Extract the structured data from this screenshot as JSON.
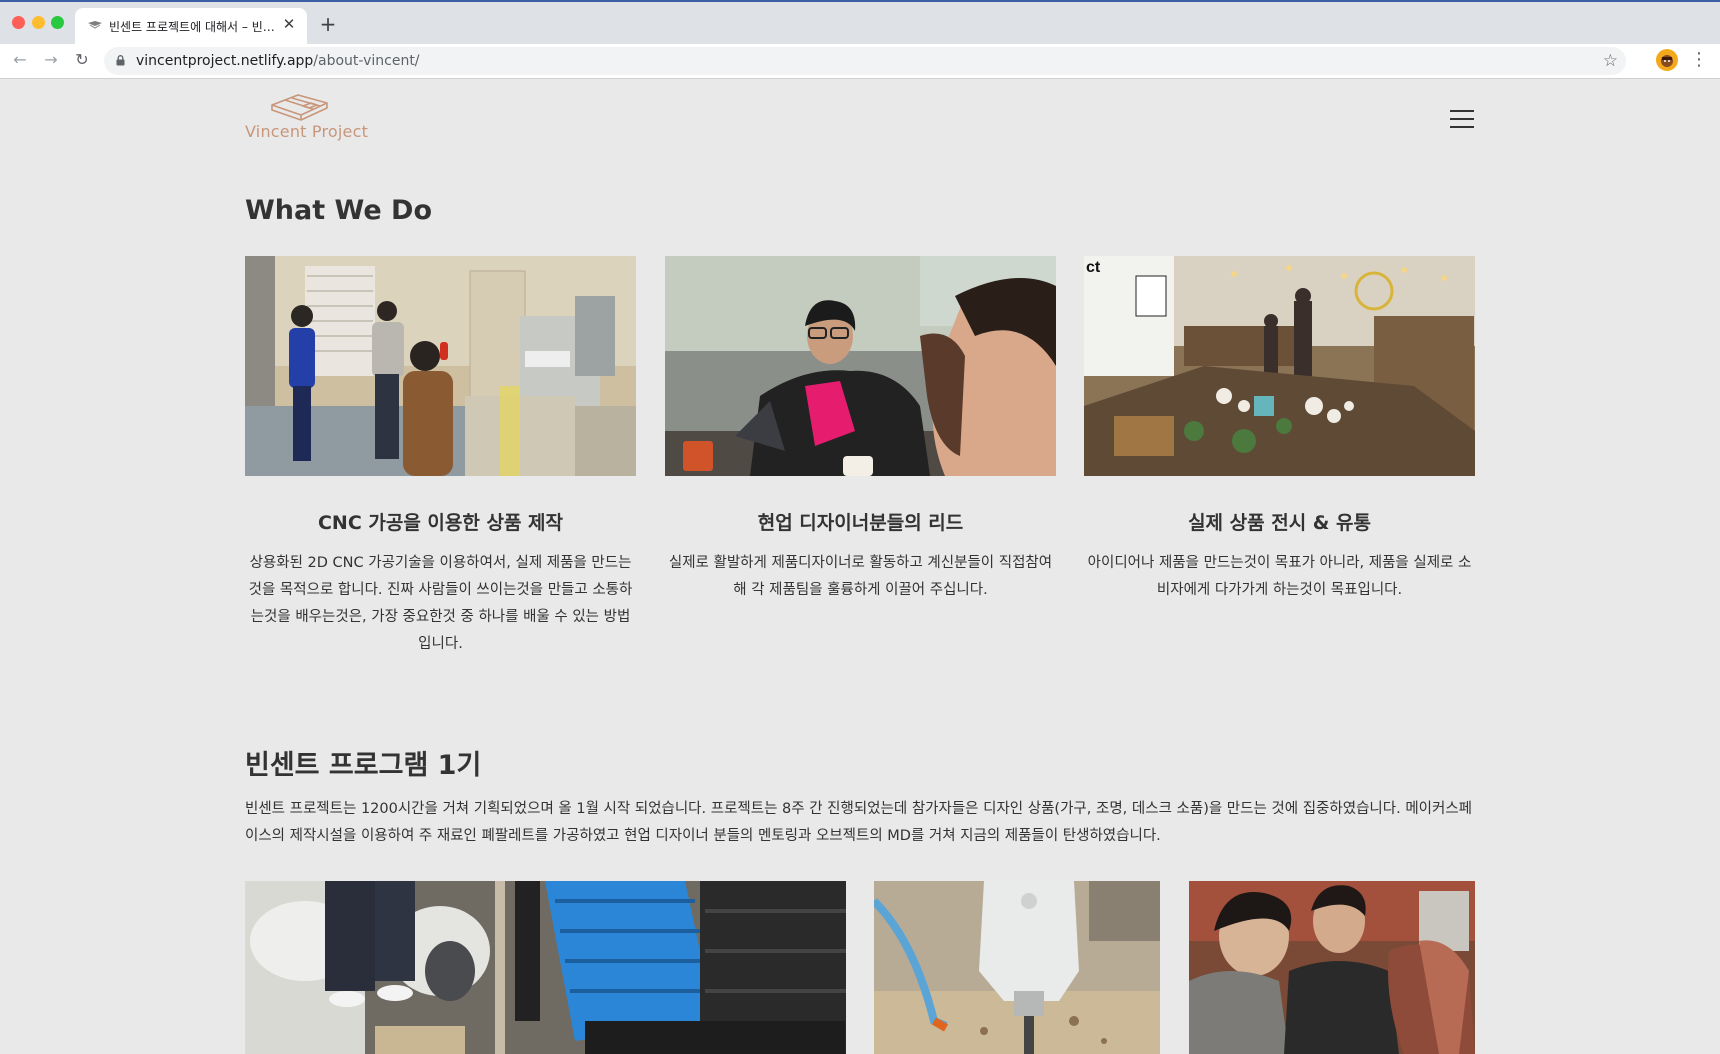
{
  "browser": {
    "tab_title": "빈센트 프로젝트에 대해서 – 빈센트 프로젝트",
    "tab_close": "✕",
    "new_tab": "+",
    "url_host": "vincentproject.netlify.app",
    "url_path": "/about-vincent/",
    "nav": {
      "back": "←",
      "forward": "→",
      "reload": "↻",
      "star": "☆",
      "menu": "⋮"
    }
  },
  "header": {
    "logo_text": "Vincent Project",
    "brand_color": "#c8967a"
  },
  "what_we_do": {
    "title": "What We Do",
    "cards": [
      {
        "title": "CNC 가공을 이용한 상품 제작",
        "text": "상용화된 2D CNC 가공기술을 이용하여서, 실제 제품을 만드는 것을 목적으로 합니다.  진짜 사람들이 쓰이는것을 만들고 소통하는것을 배우는것은, 가장 중요한것 중 하나를 배울 수 있는 방법 입니다."
      },
      {
        "title": "현업 디자이너분들의 리드",
        "text": "실제로 활발하게 제품디자이너로 활동하고 계신분들이 직접참여해 각 제품팀을 훌륭하게 이끌어 주십니다."
      },
      {
        "title": "실제 상품 전시 & 유통",
        "text": "아이디어나 제품을 만드는것이 목표가 아니라, 제품을 실제로 소비자에게 다가가게 하는것이 목표입니다."
      }
    ]
  },
  "program": {
    "title": "빈센트 프로그램 1기",
    "text": "빈센트 프로젝트는 1200시간을 거쳐 기획되었으며 올 1월 시작 되었습니다. 프로젝트는 8주 간 진행되었는데 참가자들은 디자인 상품(가구, 조명, 데스크 소품)을 만드는 것에 집중하였습니다. 메이커스페이스의 제작시설을 이용하여 주 재료인 폐팔레트를 가공하였고 현업 디자이너 분들의 멘토링과 오브젝트의 MD를 거쳐 지금의 제품들이 탄생하였습니다."
  }
}
